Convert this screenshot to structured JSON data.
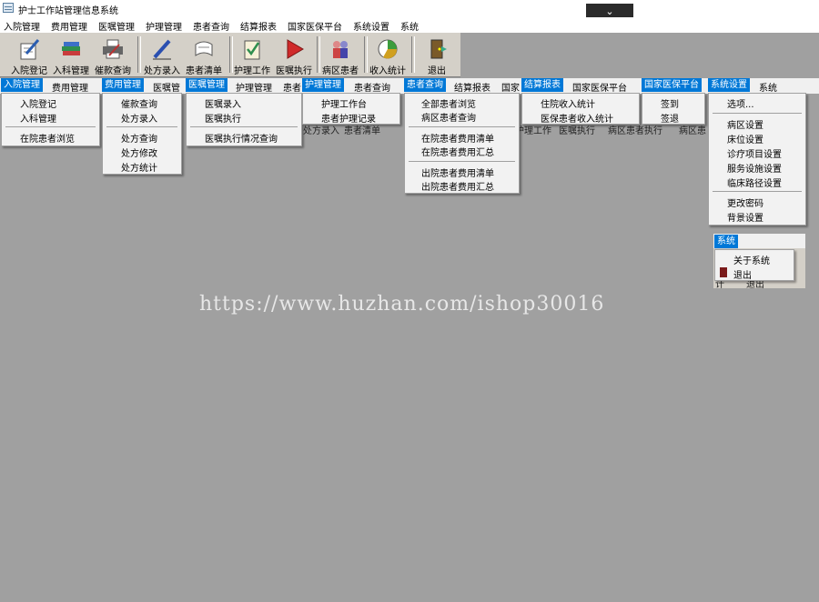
{
  "window": {
    "title": "护士工作站管理信息系统"
  },
  "menubar": [
    "入院管理",
    "费用管理",
    "医嘱管理",
    "护理管理",
    "患者查询",
    "结算报表",
    "国家医保平台",
    "系统设置",
    "系统"
  ],
  "toolbar": [
    "入院登记",
    "入科管理",
    "催款查询",
    "处方录入",
    "患者清单",
    "护理工作",
    "医嘱执行",
    "病区患者",
    "收入统计",
    "退出"
  ],
  "icons": [
    "pen-paper-icon",
    "books-icon",
    "printer-icon",
    "pen-icon",
    "scroll-icon",
    "clipboard-check-icon",
    "play-icon",
    "patients-icon",
    "chart-wheel-icon",
    "exit-door-icon"
  ],
  "menus": {
    "admission": {
      "header": "入院管理",
      "items": [
        "入院登记",
        "入科管理"
      ],
      "items2": [
        "在院患者浏览"
      ],
      "strip": [
        "费用管理"
      ]
    },
    "fees": {
      "header": "费用管理",
      "items": [
        "催款查询",
        "处方录入"
      ],
      "items2": [
        "处方查询",
        "处方修改",
        "处方统计"
      ],
      "strip": [
        "医嘱管"
      ]
    },
    "orders": {
      "header": "医嘱管理",
      "items": [
        "医嘱录入",
        "医嘱执行"
      ],
      "items2": [
        "医嘱执行情况查询"
      ],
      "strip": [
        "护理管理",
        "患者"
      ]
    },
    "nursing": {
      "header": "护理管理",
      "items": [
        "护理工作台",
        "患者护理记录"
      ],
      "strip": [
        "患者查询"
      ]
    },
    "patients": {
      "header": "患者查询",
      "items": [
        "全部患者浏览",
        "病区患者查询"
      ],
      "items2": [
        "在院患者费用清单",
        "在院患者费用汇总"
      ],
      "items3": [
        "出院患者费用清单",
        "出院患者费用汇总"
      ],
      "strip": [
        "结算报表",
        "国家"
      ]
    },
    "reports": {
      "header": "结算报表",
      "items": [
        "住院收入统计",
        "医保患者收入统计"
      ],
      "strip": [
        "国家医保平台"
      ]
    },
    "insurance": {
      "header": "国家医保平台",
      "items": [
        "签到",
        "签退"
      ]
    },
    "settings": {
      "header": "系统设置",
      "items": [
        "选项..."
      ],
      "items2": [
        "病区设置",
        "床位设置",
        "诊疗项目设置",
        "服务设施设置",
        "临床路径设置"
      ],
      "items3": [
        "更改密码",
        "背景设置"
      ],
      "strip": [
        "系统"
      ]
    },
    "system": {
      "header": "系统",
      "items": [
        "关于系统",
        "退出"
      ]
    }
  },
  "behind_text": [
    "处方录入",
    "患者清单",
    "护理工作",
    "医嘱执行",
    "病区患者执行",
    "病区患",
    "计",
    "退出"
  ],
  "watermark": "https://www.huzhan.com/ishop30016",
  "colors": {
    "highlight": "#0078d7",
    "background": "#a0a0a0",
    "toolbar": "#d4d0c8"
  }
}
